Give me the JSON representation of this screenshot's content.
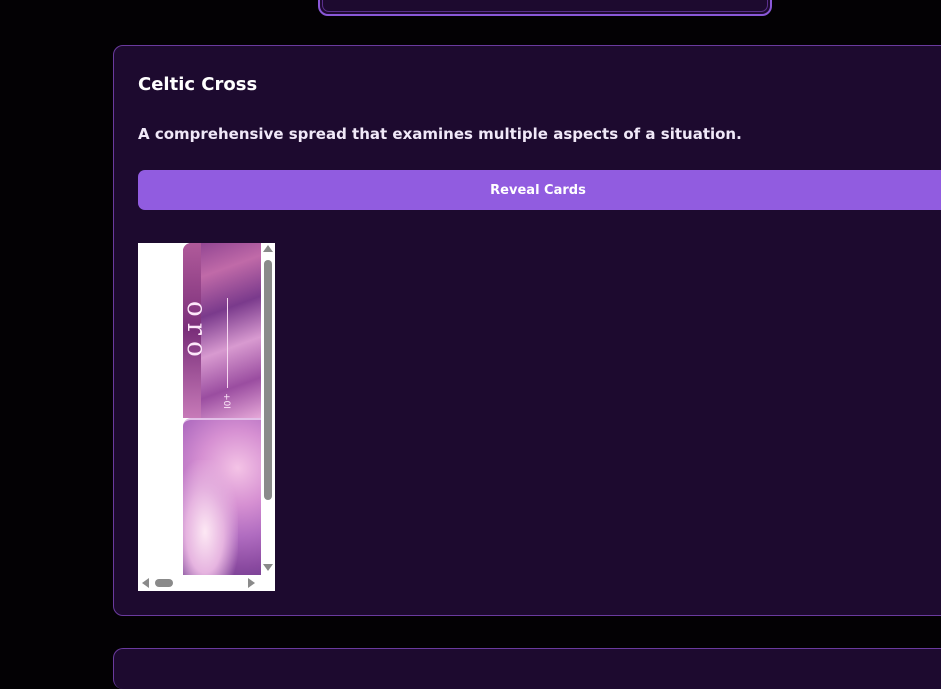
{
  "spread": {
    "title": "Celtic Cross",
    "description": "A comprehensive spread that examines multiple aspects of a situation.",
    "reveal_button_label": "Reveal Cards"
  },
  "colors": {
    "background": "#030104",
    "panel": "#1d0a2f",
    "panel_border": "#6a3a9e",
    "accent": "#915ce0"
  }
}
